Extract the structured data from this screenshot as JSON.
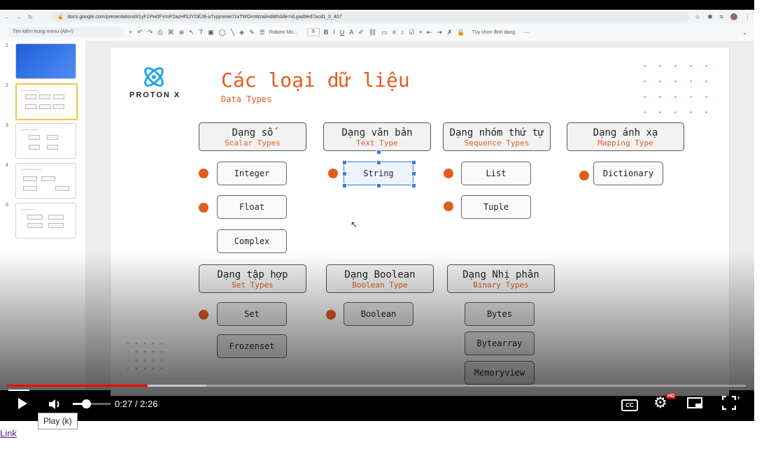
{
  "browser": {
    "url": "docs.google.com/presentation/d/1yF1Pw0FVmP2azHfSJYDEJ8-aTvpjmmie7zxTWGmWzal/edit#slide=id.gad9ed7acd1_0_407"
  },
  "editor_toolbar": {
    "menu_search_placeholder": "Tìm kiếm trong menu (Alt+/)",
    "font_name": "Roboto Mo...",
    "font_size": "9",
    "format_options": "Tùy chọn định dạng"
  },
  "thumbnails": [
    {
      "number": "1"
    },
    {
      "number": "2"
    },
    {
      "number": "3"
    },
    {
      "number": "4"
    },
    {
      "number": "5"
    }
  ],
  "slide": {
    "logo_text": "PROTON X",
    "title": "Các loại dữ liệu",
    "subtitle": "Data Types",
    "categories": {
      "scalar": {
        "name": "Dạng số",
        "en": "Scalar Types"
      },
      "text": {
        "name": "Dạng văn bản",
        "en": "Text Type"
      },
      "sequence": {
        "name": "Dạng nhóm thứ tự",
        "en": "Sequence Types"
      },
      "mapping": {
        "name": "Dạng ánh xạ",
        "en": "Mapping Type"
      },
      "set": {
        "name": "Dạng tập hợp",
        "en": "Set Types"
      },
      "boolean": {
        "name": "Dạng Boolean",
        "en": "Boolean Type"
      },
      "binary": {
        "name": "Dạng Nhị phân",
        "en": "Binary Types"
      }
    },
    "items": {
      "integer": "Integer",
      "float": "Float",
      "complex": "Complex",
      "string": "String",
      "list": "List",
      "tuple": "Tuple",
      "dictionary": "Dictionary",
      "set": "Set",
      "frozenset": "Frozenset",
      "boolean": "Boolean",
      "bytes": "Bytes",
      "bytearray": "Bytearray",
      "memoryview": "Memoryview"
    }
  },
  "player": {
    "current_time": "0:27",
    "duration": "2:26",
    "time_display": "0:27 / 2:26",
    "played_fraction": 0.19,
    "buffered_fraction": 0.27,
    "volume_fraction": 0.25,
    "cc_label": "CC",
    "hd_badge": "HD",
    "tooltip": "Play (k)"
  },
  "colors": {
    "accent": "#e25c1d",
    "progress": "#ff0000",
    "selection": "#3b78e7"
  },
  "footer": {
    "link_text": "Link"
  }
}
